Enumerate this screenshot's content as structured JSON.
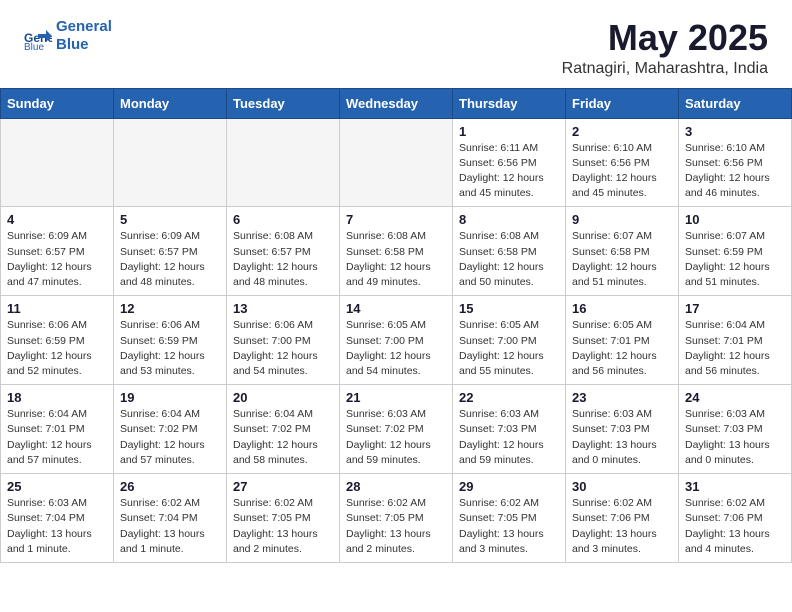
{
  "header": {
    "logo_line1": "General",
    "logo_line2": "Blue",
    "title": "May 2025",
    "subtitle": "Ratnagiri, Maharashtra, India"
  },
  "days_of_week": [
    "Sunday",
    "Monday",
    "Tuesday",
    "Wednesday",
    "Thursday",
    "Friday",
    "Saturday"
  ],
  "weeks": [
    [
      {
        "day": "",
        "info": ""
      },
      {
        "day": "",
        "info": ""
      },
      {
        "day": "",
        "info": ""
      },
      {
        "day": "",
        "info": ""
      },
      {
        "day": "1",
        "info": "Sunrise: 6:11 AM\nSunset: 6:56 PM\nDaylight: 12 hours\nand 45 minutes."
      },
      {
        "day": "2",
        "info": "Sunrise: 6:10 AM\nSunset: 6:56 PM\nDaylight: 12 hours\nand 45 minutes."
      },
      {
        "day": "3",
        "info": "Sunrise: 6:10 AM\nSunset: 6:56 PM\nDaylight: 12 hours\nand 46 minutes."
      }
    ],
    [
      {
        "day": "4",
        "info": "Sunrise: 6:09 AM\nSunset: 6:57 PM\nDaylight: 12 hours\nand 47 minutes."
      },
      {
        "day": "5",
        "info": "Sunrise: 6:09 AM\nSunset: 6:57 PM\nDaylight: 12 hours\nand 48 minutes."
      },
      {
        "day": "6",
        "info": "Sunrise: 6:08 AM\nSunset: 6:57 PM\nDaylight: 12 hours\nand 48 minutes."
      },
      {
        "day": "7",
        "info": "Sunrise: 6:08 AM\nSunset: 6:58 PM\nDaylight: 12 hours\nand 49 minutes."
      },
      {
        "day": "8",
        "info": "Sunrise: 6:08 AM\nSunset: 6:58 PM\nDaylight: 12 hours\nand 50 minutes."
      },
      {
        "day": "9",
        "info": "Sunrise: 6:07 AM\nSunset: 6:58 PM\nDaylight: 12 hours\nand 51 minutes."
      },
      {
        "day": "10",
        "info": "Sunrise: 6:07 AM\nSunset: 6:59 PM\nDaylight: 12 hours\nand 51 minutes."
      }
    ],
    [
      {
        "day": "11",
        "info": "Sunrise: 6:06 AM\nSunset: 6:59 PM\nDaylight: 12 hours\nand 52 minutes."
      },
      {
        "day": "12",
        "info": "Sunrise: 6:06 AM\nSunset: 6:59 PM\nDaylight: 12 hours\nand 53 minutes."
      },
      {
        "day": "13",
        "info": "Sunrise: 6:06 AM\nSunset: 7:00 PM\nDaylight: 12 hours\nand 54 minutes."
      },
      {
        "day": "14",
        "info": "Sunrise: 6:05 AM\nSunset: 7:00 PM\nDaylight: 12 hours\nand 54 minutes."
      },
      {
        "day": "15",
        "info": "Sunrise: 6:05 AM\nSunset: 7:00 PM\nDaylight: 12 hours\nand 55 minutes."
      },
      {
        "day": "16",
        "info": "Sunrise: 6:05 AM\nSunset: 7:01 PM\nDaylight: 12 hours\nand 56 minutes."
      },
      {
        "day": "17",
        "info": "Sunrise: 6:04 AM\nSunset: 7:01 PM\nDaylight: 12 hours\nand 56 minutes."
      }
    ],
    [
      {
        "day": "18",
        "info": "Sunrise: 6:04 AM\nSunset: 7:01 PM\nDaylight: 12 hours\nand 57 minutes."
      },
      {
        "day": "19",
        "info": "Sunrise: 6:04 AM\nSunset: 7:02 PM\nDaylight: 12 hours\nand 57 minutes."
      },
      {
        "day": "20",
        "info": "Sunrise: 6:04 AM\nSunset: 7:02 PM\nDaylight: 12 hours\nand 58 minutes."
      },
      {
        "day": "21",
        "info": "Sunrise: 6:03 AM\nSunset: 7:02 PM\nDaylight: 12 hours\nand 59 minutes."
      },
      {
        "day": "22",
        "info": "Sunrise: 6:03 AM\nSunset: 7:03 PM\nDaylight: 12 hours\nand 59 minutes."
      },
      {
        "day": "23",
        "info": "Sunrise: 6:03 AM\nSunset: 7:03 PM\nDaylight: 13 hours\nand 0 minutes."
      },
      {
        "day": "24",
        "info": "Sunrise: 6:03 AM\nSunset: 7:03 PM\nDaylight: 13 hours\nand 0 minutes."
      }
    ],
    [
      {
        "day": "25",
        "info": "Sunrise: 6:03 AM\nSunset: 7:04 PM\nDaylight: 13 hours\nand 1 minute."
      },
      {
        "day": "26",
        "info": "Sunrise: 6:02 AM\nSunset: 7:04 PM\nDaylight: 13 hours\nand 1 minute."
      },
      {
        "day": "27",
        "info": "Sunrise: 6:02 AM\nSunset: 7:05 PM\nDaylight: 13 hours\nand 2 minutes."
      },
      {
        "day": "28",
        "info": "Sunrise: 6:02 AM\nSunset: 7:05 PM\nDaylight: 13 hours\nand 2 minutes."
      },
      {
        "day": "29",
        "info": "Sunrise: 6:02 AM\nSunset: 7:05 PM\nDaylight: 13 hours\nand 3 minutes."
      },
      {
        "day": "30",
        "info": "Sunrise: 6:02 AM\nSunset: 7:06 PM\nDaylight: 13 hours\nand 3 minutes."
      },
      {
        "day": "31",
        "info": "Sunrise: 6:02 AM\nSunset: 7:06 PM\nDaylight: 13 hours\nand 4 minutes."
      }
    ]
  ]
}
